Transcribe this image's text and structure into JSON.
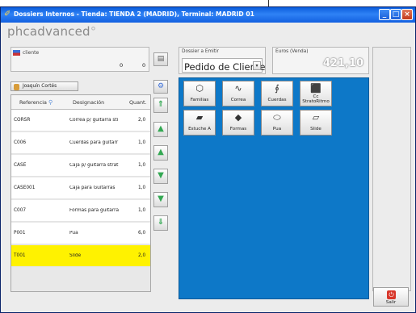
{
  "window": {
    "title": "Dossiers Internos - Tienda: TIENDA 2 (MADRID), Terminal: MADRID 01",
    "minimize_icon": "minimize-icon",
    "maximize_icon": "maximize-icon",
    "close_icon": "close-icon"
  },
  "logo": {
    "text": "phcadvanced",
    "mark": "°"
  },
  "client": {
    "label": "cliente",
    "value1": "0",
    "value2": "0",
    "button_icon": "client-search-icon"
  },
  "dossier": {
    "label": "Dossier a Emitir",
    "selected": "Pedido de Cliente",
    "dropdown_glyph": "▾"
  },
  "euros": {
    "label": "Euros (Venda)",
    "value": "421,10"
  },
  "operator": {
    "name": "Joaquín Cortés"
  },
  "table": {
    "headers": {
      "referencia": "Referencia",
      "designacion": "Designación",
      "quantidade": "Quant."
    },
    "rows": [
      {
        "ref": "CORSR",
        "des": "Correa p/ guitarra sti",
        "qty": "2,0"
      },
      {
        "ref": "C006",
        "des": "Cuerdas para guitarr",
        "qty": "1,0"
      },
      {
        "ref": "CASE",
        "des": "Caja p/ guitarra strat",
        "qty": "1,0"
      },
      {
        "ref": "CASE001",
        "des": "Caja para Guitarras",
        "qty": "1,0"
      },
      {
        "ref": "C007",
        "des": "Formas para guitarra",
        "qty": "1,0"
      },
      {
        "ref": "P001",
        "des": "Pua",
        "qty": "6,0"
      },
      {
        "ref": "T001",
        "des": "Slide",
        "qty": "2,0",
        "selected": true
      }
    ]
  },
  "nav_buttons": [
    "first-icon",
    "up-icon",
    "up-icon",
    "down-icon",
    "down-icon",
    "last-icon"
  ],
  "tiles": [
    {
      "label": "Familias",
      "icon": "families-icon"
    },
    {
      "label": "Correa",
      "icon": "strap-icon"
    },
    {
      "label": "Cuerdas",
      "icon": "strings-icon"
    },
    {
      "label": "Cc StratoRitmo",
      "icon": "guitar-icon"
    },
    {
      "label": "Estuche A",
      "icon": "case-icon"
    },
    {
      "label": "Formas",
      "icon": "forms-icon"
    },
    {
      "label": "Pua",
      "icon": "pick-icon"
    },
    {
      "label": "Slide",
      "icon": "slide-icon"
    }
  ],
  "exit": {
    "label": "Salir",
    "icon": "exit-icon"
  }
}
